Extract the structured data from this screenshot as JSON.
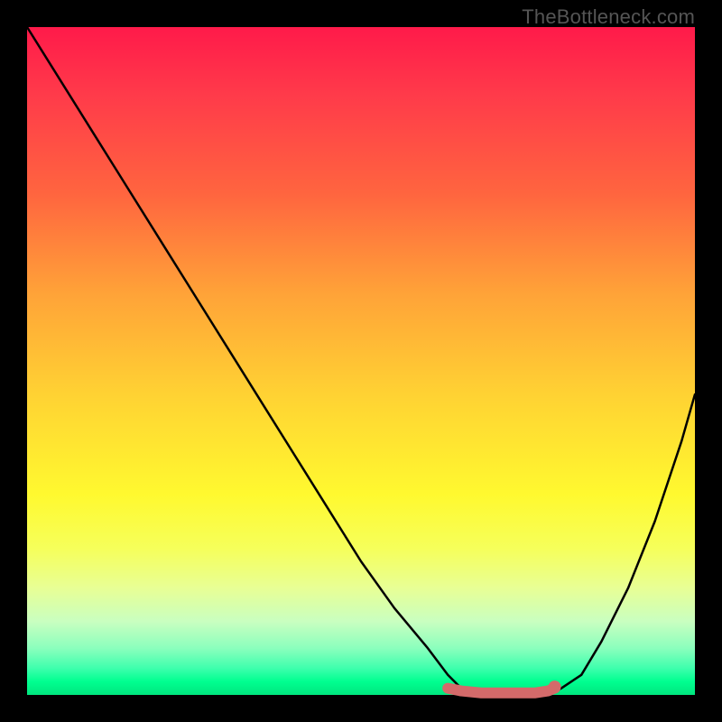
{
  "watermark": "TheBottleneck.com",
  "chart_data": {
    "type": "line",
    "title": "",
    "xlabel": "",
    "ylabel": "",
    "xlim": [
      0,
      100
    ],
    "ylim": [
      0,
      100
    ],
    "series": [
      {
        "name": "bottleneck-curve",
        "x": [
          0,
          5,
          10,
          15,
          20,
          25,
          30,
          35,
          40,
          45,
          50,
          55,
          60,
          63,
          65,
          68,
          72,
          76,
          78,
          80,
          83,
          86,
          90,
          94,
          98,
          100
        ],
        "y": [
          100,
          92,
          84,
          76,
          68,
          60,
          52,
          44,
          36,
          28,
          20,
          13,
          7,
          3,
          1,
          0,
          0,
          0,
          0,
          1,
          3,
          8,
          16,
          26,
          38,
          45
        ],
        "color": "#000000"
      },
      {
        "name": "flat-region",
        "x": [
          63,
          65,
          68,
          72,
          76,
          78,
          79
        ],
        "y": [
          1,
          0.6,
          0.3,
          0.3,
          0.3,
          0.6,
          1
        ],
        "color": "#d46a6a"
      }
    ],
    "markers": [
      {
        "name": "flat-region-end-dot",
        "x": 79,
        "y": 1.2,
        "color": "#d46a6a"
      }
    ]
  }
}
